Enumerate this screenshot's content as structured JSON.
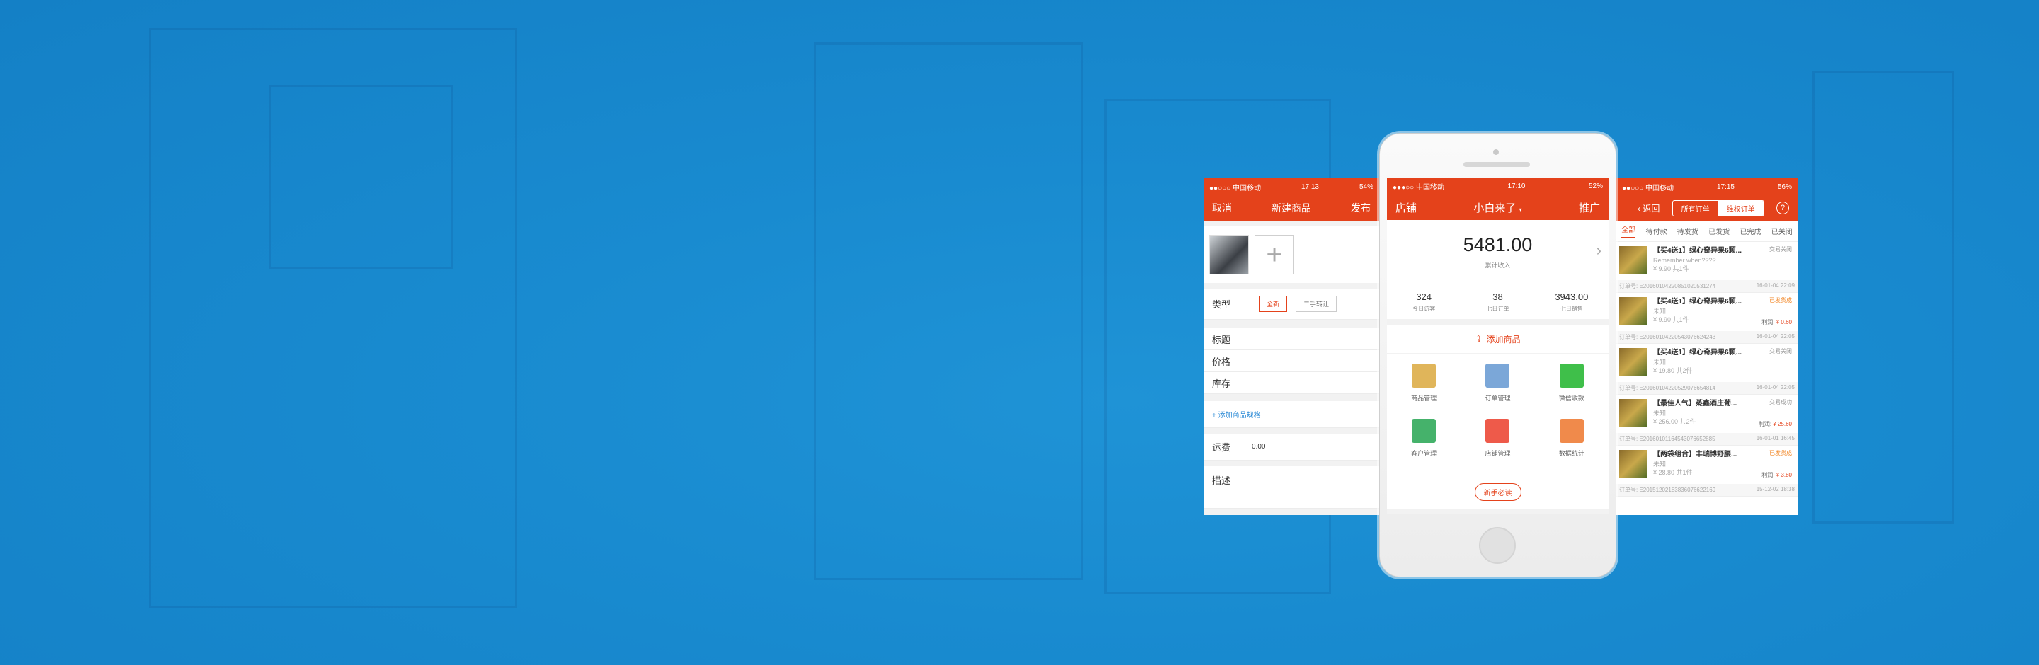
{
  "left": {
    "status": {
      "carrier": "●●○○○ 中国移动",
      "time": "17:13",
      "battery": "54%"
    },
    "nav": {
      "cancel": "取消",
      "title": "新建商品",
      "publish": "发布"
    },
    "type_label": "类型",
    "types": [
      "全新",
      "二手转让"
    ],
    "fields": [
      "标题",
      "价格",
      "库存"
    ],
    "add_spec": "+ 添加商品规格",
    "shipping_label": "运费",
    "shipping_value": "0.00",
    "desc_label": "描述"
  },
  "mid": {
    "status": {
      "carrier": "●●●○○ 中国移动",
      "time": "17:10",
      "battery": "52%"
    },
    "nav": {
      "left": "店铺",
      "title": "小白来了",
      "right": "推广"
    },
    "income": {
      "value": "5481.00",
      "label": "累计收入"
    },
    "stats": [
      {
        "value": "324",
        "label": "今日访客"
      },
      {
        "value": "38",
        "label": "七日订单"
      },
      {
        "value": "3943.00",
        "label": "七日销售"
      }
    ],
    "add_product": "添加商品",
    "grid": [
      {
        "label": "商品管理",
        "icon": "box-icon",
        "color": "#e0b55a"
      },
      {
        "label": "订单管理",
        "icon": "clipboard-icon",
        "color": "#7ba7d8"
      },
      {
        "label": "微信收款",
        "icon": "wechat-icon",
        "color": "#3fbf4a"
      },
      {
        "label": "客户管理",
        "icon": "contact-card-icon",
        "color": "#45b26b"
      },
      {
        "label": "店铺管理",
        "icon": "storefront-icon",
        "color": "#ee5a4a"
      },
      {
        "label": "数据统计",
        "icon": "chart-icon",
        "color": "#f08a4b"
      }
    ],
    "novice": "新手必读"
  },
  "right": {
    "status": {
      "carrier": "●●○○○ 中国移动",
      "time": "17:15",
      "battery": "56%"
    },
    "nav": {
      "back": "返回",
      "seg": [
        "所有订单",
        "维权订单"
      ],
      "help": "?"
    },
    "tabs": [
      "全部",
      "待付款",
      "待发货",
      "已发货",
      "已完成",
      "已关闭"
    ],
    "orders": [
      {
        "title": "【买4送1】绿心奇异果6颗...",
        "sub": "Remember when????",
        "price": "¥ 9.90  共1件",
        "status": "交易关闭",
        "amount_label": "",
        "amount": "",
        "no": "订单号: E20160104220851020531274",
        "date": "16-01-04 22:09"
      },
      {
        "title": "【买4送1】绿心奇异果6颗...",
        "sub": "未知",
        "price": "¥ 9.90  共1件",
        "status": "已发货成",
        "amount_label": "利润:",
        "amount": "¥ 0.60",
        "no": "订单号: E20160104220543076624243",
        "date": "16-01-04 22:05"
      },
      {
        "title": "【买4送1】绿心奇异果6颗...",
        "sub": "未知",
        "price": "¥ 19.80  共2件",
        "status": "交易关闭",
        "amount_label": "",
        "amount": "",
        "no": "订单号: E20160104220529076654814",
        "date": "16-01-04 22:05"
      },
      {
        "title": "【最佳人气】蒸鑫酒庄葡...",
        "sub": "未知",
        "price": "¥ 256.00  共2件",
        "status": "交易成功",
        "amount_label": "利润:",
        "amount": "¥ 25.60",
        "no": "订单号: E20160101164543076652885",
        "date": "16-01-01 16:45"
      },
      {
        "title": "【两袋组合】丰瑞博野腰...",
        "sub": "未知",
        "price": "¥ 28.80  共1件",
        "status": "已发货成",
        "amount_label": "利润:",
        "amount": "¥ 3.80",
        "no": "订单号: E20151202183836076622169",
        "date": "15-12-02 18:38"
      }
    ]
  }
}
